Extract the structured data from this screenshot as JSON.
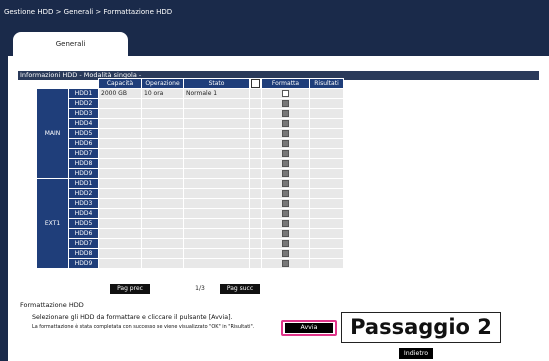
{
  "breadcrumb": "Gestione HDD > Generali > Formattazione HDD",
  "tabs": [
    {
      "label": "Generali"
    }
  ],
  "section": {
    "title": "Informazioni HDD - Modalità singola -"
  },
  "table": {
    "headers": {
      "capacity": "Capacità",
      "operation": "Operazione",
      "state": "Stato",
      "format": "Formatta",
      "results": "Risultati"
    },
    "groups": [
      {
        "name": "MAIN",
        "rows": [
          {
            "hdd": "HDD1",
            "capacity": "2000 GB",
            "operation": "10 ora",
            "state": "Normale 1",
            "checkbox": "white"
          },
          {
            "hdd": "HDD2",
            "capacity": "",
            "operation": "",
            "state": "",
            "checkbox": "dark"
          },
          {
            "hdd": "HDD3",
            "capacity": "",
            "operation": "",
            "state": "",
            "checkbox": "dark"
          },
          {
            "hdd": "HDD4",
            "capacity": "",
            "operation": "",
            "state": "",
            "checkbox": "dark"
          },
          {
            "hdd": "HDD5",
            "capacity": "",
            "operation": "",
            "state": "",
            "checkbox": "dark"
          },
          {
            "hdd": "HDD6",
            "capacity": "",
            "operation": "",
            "state": "",
            "checkbox": "dark"
          },
          {
            "hdd": "HDD7",
            "capacity": "",
            "operation": "",
            "state": "",
            "checkbox": "dark"
          },
          {
            "hdd": "HDD8",
            "capacity": "",
            "operation": "",
            "state": "",
            "checkbox": "dark"
          },
          {
            "hdd": "HDD9",
            "capacity": "",
            "operation": "",
            "state": "",
            "checkbox": "dark"
          }
        ]
      },
      {
        "name": "EXT1",
        "rows": [
          {
            "hdd": "HDD1",
            "capacity": "",
            "operation": "",
            "state": "",
            "checkbox": "dark"
          },
          {
            "hdd": "HDD2",
            "capacity": "",
            "operation": "",
            "state": "",
            "checkbox": "dark"
          },
          {
            "hdd": "HDD3",
            "capacity": "",
            "operation": "",
            "state": "",
            "checkbox": "dark"
          },
          {
            "hdd": "HDD4",
            "capacity": "",
            "operation": "",
            "state": "",
            "checkbox": "dark"
          },
          {
            "hdd": "HDD5",
            "capacity": "",
            "operation": "",
            "state": "",
            "checkbox": "dark"
          },
          {
            "hdd": "HDD6",
            "capacity": "",
            "operation": "",
            "state": "",
            "checkbox": "dark"
          },
          {
            "hdd": "HDD7",
            "capacity": "",
            "operation": "",
            "state": "",
            "checkbox": "dark"
          },
          {
            "hdd": "HDD8",
            "capacity": "",
            "operation": "",
            "state": "",
            "checkbox": "dark"
          },
          {
            "hdd": "HDD9",
            "capacity": "",
            "operation": "",
            "state": "",
            "checkbox": "dark"
          }
        ]
      }
    ]
  },
  "pager": {
    "prev": "Pag prec",
    "page": "1/3",
    "next": "Pag succ"
  },
  "format_section": {
    "title": "Formattazione HDD",
    "instruction": "Selezionare gli HDD da formattare e cliccare il pulsante [Avvia].",
    "note": "La formattazione è stata completata con successo se viene visualizzato \"OK\" in \"Risultati\"."
  },
  "buttons": {
    "start": "Avvia",
    "back": "Indietro"
  },
  "step_label": "Passaggio 2",
  "colors": {
    "accent": "#1f3e7a",
    "highlight": "#e0358a",
    "background": "#1a2a4a"
  }
}
